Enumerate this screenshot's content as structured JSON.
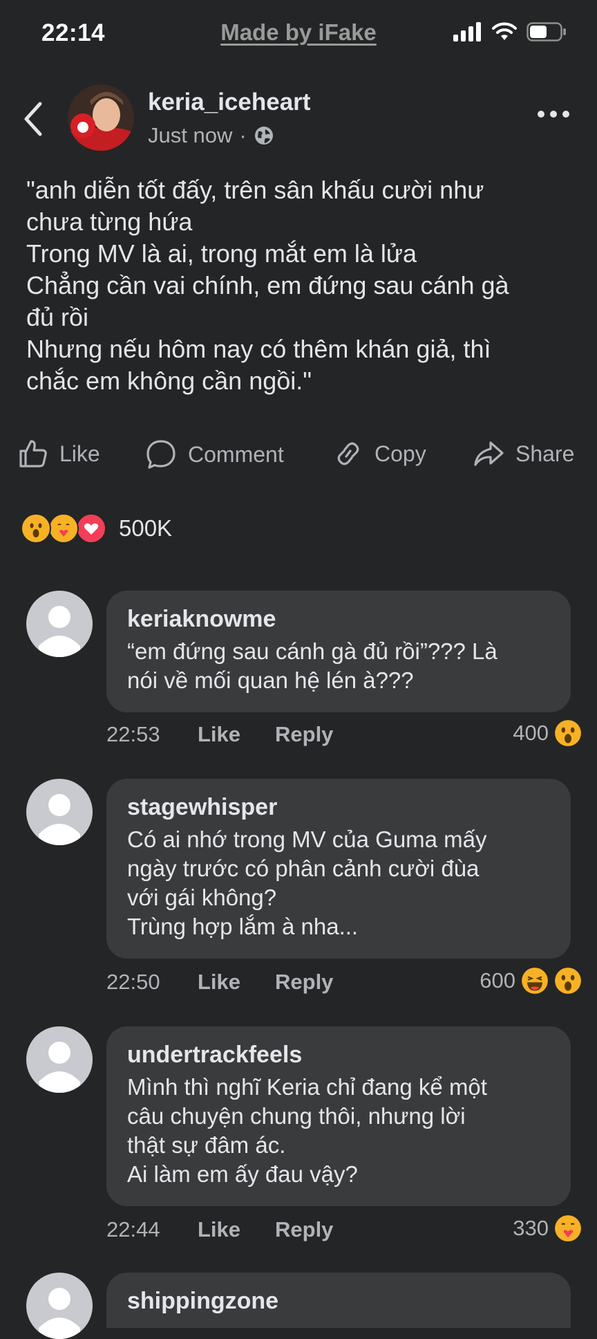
{
  "status_bar": {
    "time": "22:14",
    "watermark": "Made by iFake"
  },
  "post": {
    "author": "keria_iceheart",
    "timestamp": "Just now",
    "separator": "·",
    "text": "\"anh diễn tốt đấy, trên sân khấu cười như\nchưa từng hứa\nTrong MV là ai, trong mắt em là lửa\nChẳng cần vai chính, em đứng sau cánh gà\nđủ rồi\nNhưng nếu hôm nay có thêm khán giả, thì\nchắc em không cần ngồi.\"",
    "actions": {
      "like": "Like",
      "comment": "Comment",
      "copy": "Copy",
      "share": "Share"
    },
    "reactions": {
      "icons": [
        "wow-icon",
        "care-icon",
        "love-icon"
      ],
      "count": "500K"
    }
  },
  "comments": [
    {
      "name": "keriaknowme",
      "text": "“em đứng sau cánh gà đủ rồi”??? Là\nnói về mối quan hệ lén à???",
      "time": "22:53",
      "like": "Like",
      "reply": "Reply",
      "count": "400",
      "emojis": [
        "wow-icon"
      ]
    },
    {
      "name": "stagewhisper",
      "text": "Có ai nhớ trong MV của Guma mấy\nngày trước có phân cảnh cười đùa\nvới gái không?\nTrùng hợp lắm à nha...",
      "time": "22:50",
      "like": "Like",
      "reply": "Reply",
      "count": "600",
      "emojis": [
        "haha-icon",
        "wow-icon"
      ]
    },
    {
      "name": "undertrackfeels",
      "text": "Mình thì nghĩ Keria chỉ đang kể một\ncâu chuyện chung thôi, nhưng lời\nthật sự đâm ác.\nAi làm em ấy đau vậy?",
      "time": "22:44",
      "like": "Like",
      "reply": "Reply",
      "count": "330",
      "emojis": [
        "care-icon"
      ]
    },
    {
      "name": "shippingzone"
    }
  ],
  "colors": {
    "background": "#242526",
    "bubble": "#3a3b3c",
    "text": "#e4e6eb",
    "muted": "#b0b3b8",
    "love": "#f33e58",
    "wow": "#f7b125"
  }
}
